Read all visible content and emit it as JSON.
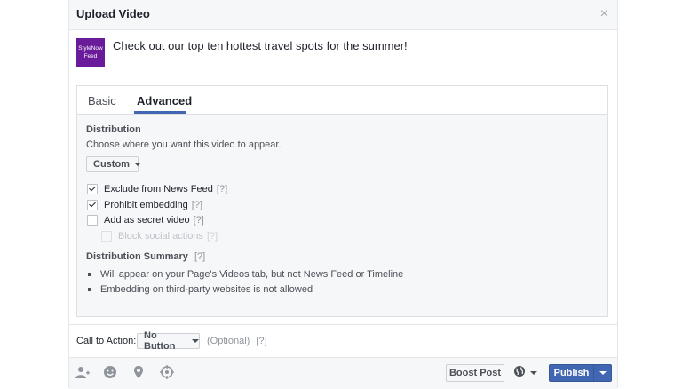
{
  "dialog": {
    "title": "Upload Video",
    "close_icon": "×"
  },
  "post": {
    "avatar_line1": "StyleNow",
    "avatar_line2": "Feed",
    "text": "Check out our top ten hottest travel spots for the summer!"
  },
  "tabs": {
    "basic": "Basic",
    "advanced": "Advanced",
    "active": "Advanced"
  },
  "distribution": {
    "title": "Distribution",
    "description": "Choose where you want this video to appear.",
    "selected": "Custom",
    "options": [
      {
        "label": "Exclude from News Feed",
        "help": "[?]",
        "checked": true,
        "disabled": false
      },
      {
        "label": "Prohibit embedding",
        "help": "[?]",
        "checked": true,
        "disabled": false
      },
      {
        "label": "Add as secret video",
        "help": "[?]",
        "checked": false,
        "disabled": false
      },
      {
        "label": "Block social actions",
        "help": "[?]",
        "checked": false,
        "disabled": true
      }
    ]
  },
  "summary": {
    "title": "Distribution Summary",
    "help": "[?]",
    "items": [
      "Will appear on your Page's Videos tab, but not News Feed or Timeline",
      "Embedding on third-party websites is not allowed"
    ]
  },
  "cta": {
    "label": "Call to Action:",
    "selected": "No Button",
    "optional": "(Optional)",
    "help": "[?]"
  },
  "footer": {
    "icons": [
      "tag-people-icon",
      "feeling-icon",
      "location-pin-icon",
      "target-icon",
      "globe-icon"
    ],
    "boost": "Boost Post",
    "publish": "Publish"
  },
  "colors": {
    "brand_blue": "#4267b2",
    "avatar_purple": "#6a1b9a",
    "panel_bg": "#f6f7f9"
  }
}
